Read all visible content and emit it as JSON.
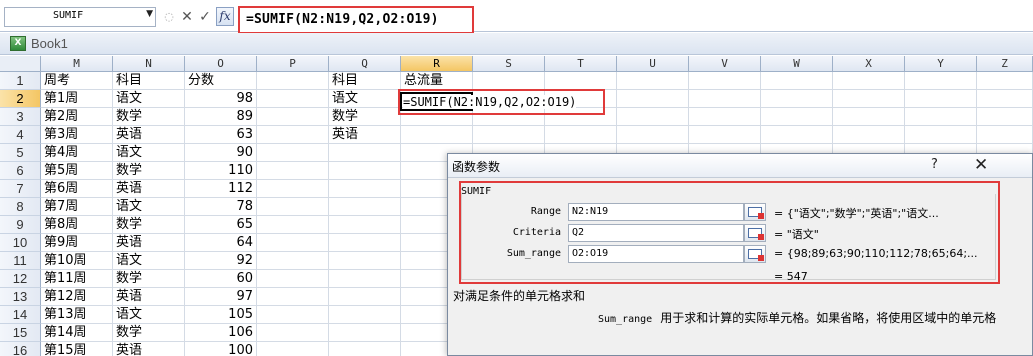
{
  "formula_bar": {
    "name_box": "SUMIF",
    "cancel_glyph": "✕",
    "enter_glyph": "✓",
    "fx_label": "fx",
    "formula": "=SUMIF(N2:N19,Q2,O2:O19)"
  },
  "workbook": {
    "title": "Book1",
    "icon": "excel-workbook-icon"
  },
  "columns": [
    "M",
    "N",
    "O",
    "P",
    "Q",
    "R",
    "S",
    "T",
    "U",
    "V",
    "W",
    "X",
    "Y",
    "Z"
  ],
  "selected_column": "R",
  "selected_row": "2",
  "rows": [
    {
      "n": "1",
      "M": "周考",
      "N": "科目",
      "O": "分数",
      "Q": "科目",
      "R": "总流量"
    },
    {
      "n": "2",
      "M": "第1周",
      "N": "语文",
      "O": "98",
      "Q": "语文",
      "R": "=SUMIF(N2:N19,Q2,O2:O19)"
    },
    {
      "n": "3",
      "M": "第2周",
      "N": "数学",
      "O": "89",
      "Q": "数学"
    },
    {
      "n": "4",
      "M": "第3周",
      "N": "英语",
      "O": "63",
      "Q": "英语"
    },
    {
      "n": "5",
      "M": "第4周",
      "N": "语文",
      "O": "90"
    },
    {
      "n": "6",
      "M": "第5周",
      "N": "数学",
      "O": "110"
    },
    {
      "n": "7",
      "M": "第6周",
      "N": "英语",
      "O": "112"
    },
    {
      "n": "8",
      "M": "第7周",
      "N": "语文",
      "O": "78"
    },
    {
      "n": "9",
      "M": "第8周",
      "N": "数学",
      "O": "65"
    },
    {
      "n": "10",
      "M": "第9周",
      "N": "英语",
      "O": "64"
    },
    {
      "n": "11",
      "M": "第10周",
      "N": "语文",
      "O": "92"
    },
    {
      "n": "12",
      "M": "第11周",
      "N": "数学",
      "O": "60"
    },
    {
      "n": "13",
      "M": "第12周",
      "N": "英语",
      "O": "97"
    },
    {
      "n": "14",
      "M": "第13周",
      "N": "语文",
      "O": "105"
    },
    {
      "n": "15",
      "M": "第14周",
      "N": "数学",
      "O": "106"
    },
    {
      "n": "16",
      "M": "第15周",
      "N": "英语",
      "O": "100"
    }
  ],
  "dialog": {
    "title": "函数参数",
    "help": "?",
    "close": "✕",
    "function_name": "SUMIF",
    "args": [
      {
        "label": "Range",
        "value": "N2:N19",
        "result": "= {\"语文\";\"数学\";\"英语\";\"语文..."
      },
      {
        "label": "Criteria",
        "value": "Q2",
        "result": "= \"语文\""
      },
      {
        "label": "Sum_range",
        "value": "O2:O19",
        "result": "= {98;89;63;90;110;112;78;65;64;..."
      }
    ],
    "result": "= 547",
    "description": "对满足条件的单元格求和",
    "hint_label": "Sum_range",
    "hint_text": "用于求和计算的实际单元格。如果省略，将使用区域中的单元格"
  }
}
